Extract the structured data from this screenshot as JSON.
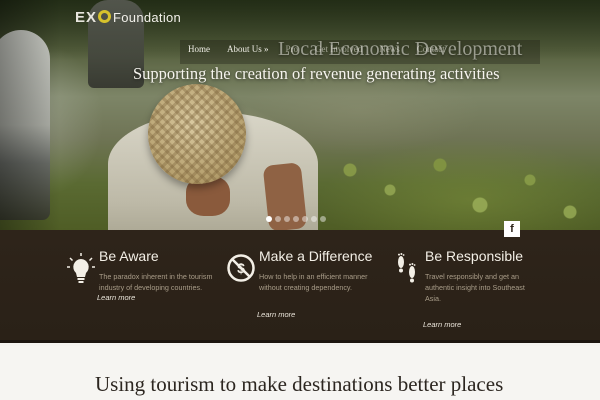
{
  "logo": {
    "mark": "EX",
    "mark_end": "O",
    "text": "Foundation"
  },
  "nav": {
    "items": [
      {
        "label": "Home"
      },
      {
        "label": "About Us »"
      },
      {
        "label": "Pro"
      },
      {
        "label": "Get Involved"
      },
      {
        "label": "News"
      },
      {
        "label": "Contact"
      }
    ]
  },
  "hero": {
    "title": "Local Economic Development",
    "subtitle": "Supporting the creation of revenue generating activities",
    "slides_count": 7,
    "active_slide": 1
  },
  "social": {
    "facebook_label": "f"
  },
  "features": [
    {
      "icon": "lightbulb-icon",
      "title": "Be Aware",
      "text": "The paradox inherent in the tourism industry of developing countries.",
      "link": "Learn more"
    },
    {
      "icon": "no-money-icon",
      "title": "Make a Difference",
      "text": "How to help in an efficient manner without creating dependency.",
      "link": "Learn more"
    },
    {
      "icon": "footprints-icon",
      "title": "Be Responsible",
      "text": "Travel responsibly and get an authentic insight into Southeast Asia.",
      "link": "Learn more"
    }
  ],
  "tagline": "Using tourism to make destinations better places",
  "colors": {
    "band": "#2e241a",
    "accent_logo": "#d7c22c",
    "background": "#f6f5f2"
  }
}
